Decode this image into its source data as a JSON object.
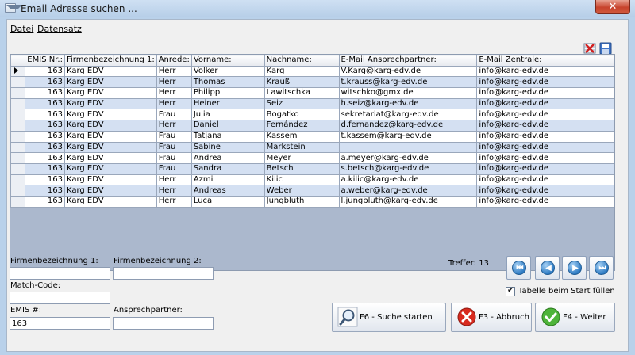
{
  "window": {
    "title": "Email Adresse suchen ...",
    "close_glyph": "✕"
  },
  "menu": {
    "items": [
      "Datei",
      "Datensatz"
    ]
  },
  "toolbar": {
    "icons": [
      "delete-grid-icon",
      "save-disk-icon"
    ]
  },
  "table": {
    "columns": [
      "EMIS Nr.:",
      "Firmenbezeichnung 1:",
      "Anrede:",
      "Vorname:",
      "Nachname:",
      "E-Mail Ansprechpartner:",
      "E-Mail Zentrale:"
    ],
    "rows": [
      [
        "163",
        "Karg EDV",
        "Herr",
        "Volker",
        "Karg",
        "V.Karg@karg-edv.de",
        "info@karg-edv.de"
      ],
      [
        "163",
        "Karg EDV",
        "Herr",
        "Thomas",
        "Krauß",
        "t.krauss@karg-edv.de",
        "info@karg-edv.de"
      ],
      [
        "163",
        "Karg EDV",
        "Herr",
        "Philipp",
        "Lawitschka",
        "witschko@gmx.de",
        "info@karg-edv.de"
      ],
      [
        "163",
        "Karg EDV",
        "Herr",
        "Heiner",
        "Seiz",
        "h.seiz@karg-edv.de",
        "info@karg-edv.de"
      ],
      [
        "163",
        "Karg EDV",
        "Frau",
        "Julia",
        "Bogatko",
        "sekretariat@karg-edv.de",
        "info@karg-edv.de"
      ],
      [
        "163",
        "Karg EDV",
        "Herr",
        "Daniel",
        "Fernández",
        "d.fernandez@karg-edv.de",
        "info@karg-edv.de"
      ],
      [
        "163",
        "Karg EDV",
        "Frau",
        "Tatjana",
        "Kassem",
        "t.kassem@karg-edv.de",
        "info@karg-edv.de"
      ],
      [
        "163",
        "Karg EDV",
        "Frau",
        "Sabine",
        "Markstein",
        "",
        "info@karg-edv.de"
      ],
      [
        "163",
        "Karg EDV",
        "Frau",
        "Andrea",
        "Meyer",
        "a.meyer@karg-edv.de",
        "info@karg-edv.de"
      ],
      [
        "163",
        "Karg EDV",
        "Frau",
        "Sandra",
        "Betsch",
        "s.betsch@karg-edv.de",
        "info@karg-edv.de"
      ],
      [
        "163",
        "Karg EDV",
        "Herr",
        "Azmi",
        "Kilic",
        "a.kilic@karg-edv.de",
        "info@karg-edv.de"
      ],
      [
        "163",
        "Karg EDV",
        "Herr",
        "Andreas",
        "Weber",
        "a.weber@karg-edv.de",
        "info@karg-edv.de"
      ],
      [
        "163",
        "Karg EDV",
        "Herr",
        "Luca",
        "Jungbluth",
        "l.jungbluth@karg-edv.de",
        "info@karg-edv.de"
      ]
    ]
  },
  "form": {
    "firma1_label": "Firmenbezeichnung 1:",
    "firma1_value": "",
    "firma2_label": "Firmenbezeichnung 2:",
    "firma2_value": "",
    "matchcode_label": "Match-Code:",
    "matchcode_value": "",
    "emis_label": "EMIS #:",
    "emis_value": "163",
    "ansprech_label": "Ansprechpartner:",
    "ansprech_value": ""
  },
  "status": {
    "treffer": "Treffer: 13"
  },
  "nav": {
    "glyphs": [
      "⏮",
      "◀",
      "▶",
      "⏭"
    ]
  },
  "options": {
    "fill_on_start_label": "Tabelle beim Start füllen",
    "fill_on_start_checked": true
  },
  "buttons": {
    "search": "F6 - Suche starten",
    "cancel": "F3 - Abbruch",
    "next": "F4 - Weiter"
  },
  "colors": {
    "row_alt": "#d4e0f2",
    "grid_bg": "#abb8cd",
    "accent": "#2f7cc4"
  }
}
